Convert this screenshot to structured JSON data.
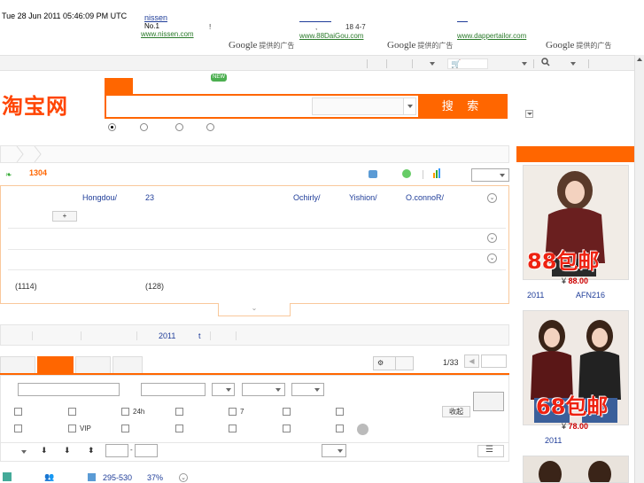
{
  "timestamp": "Tue 28 Jun 2011 05:46:09 PM UTC",
  "ads": [
    {
      "title": "nissen",
      "desc": "No.1",
      "url": "www.nissen.com"
    },
    {
      "title": "",
      "desc": "!",
      "desc2": ",",
      "desc3": "18   4-7",
      "url": "www.88DaiGou.com"
    },
    {
      "title": "",
      "desc": "",
      "url": "www.dappertailor.com"
    }
  ],
  "google_label": "Google",
  "google_ad_text": "提供的广告",
  "logo_text": "淘宝网",
  "new_badge": "NEW",
  "search": {
    "button": "搜 索",
    "placeholder": "",
    "category": ""
  },
  "stats": {
    "count": "1304"
  },
  "filter": {
    "brands": [
      "Hongdou/",
      "23",
      "Ochirly/",
      "Yishion/",
      "O.connoR/"
    ],
    "more_button": "+",
    "counts": [
      "(1114)",
      "(128)"
    ],
    "expand": "⌄"
  },
  "related": {
    "year": "2011",
    "t": "t"
  },
  "pager": {
    "page": "1/33"
  },
  "toolbar": {
    "label_24h": "24h",
    "label_7": "7",
    "label_vip": "VIP",
    "collapse": "收起"
  },
  "result": {
    "range": "295-530",
    "percent": "37%"
  },
  "products": [
    {
      "banner": "88包邮",
      "currency": "¥",
      "price": "88.00",
      "year": "2011",
      "code": "AFN216"
    },
    {
      "banner": "68包邮",
      "currency": "¥",
      "price": "78.00",
      "year": "2011",
      "code": ""
    }
  ],
  "colors": {
    "accent": "#ff6600",
    "logo": "#ff4400",
    "link": "#1f3d99",
    "url": "#2a7a2a"
  }
}
